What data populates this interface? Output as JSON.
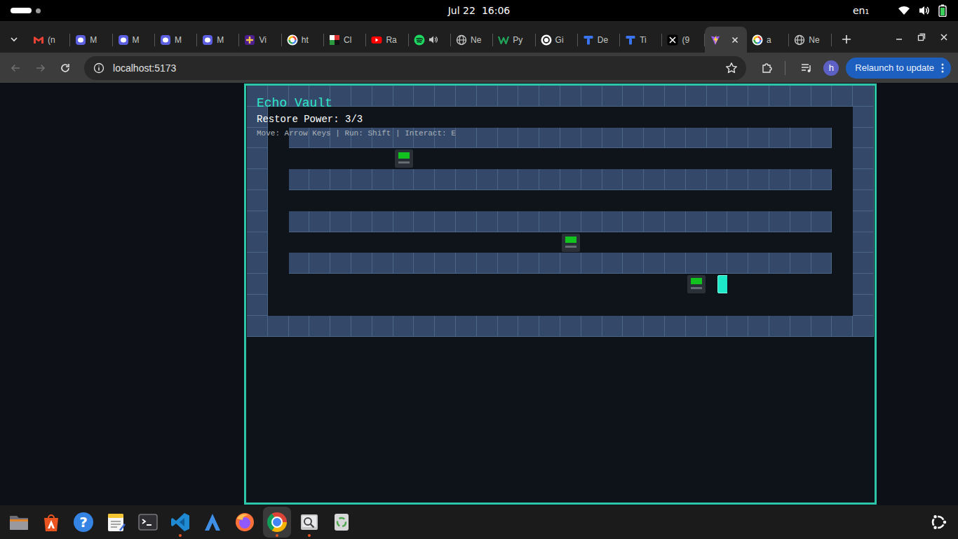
{
  "top_bar": {
    "date": "Jul 22",
    "time": "16:06",
    "keyboard_layout": "en₁"
  },
  "browser": {
    "tabs": [
      {
        "label": "(n",
        "kind": "gmail",
        "selected": false,
        "audio": false
      },
      {
        "label": "M",
        "kind": "mastodon",
        "selected": false,
        "audio": false
      },
      {
        "label": "M",
        "kind": "mastodon",
        "selected": false,
        "audio": false
      },
      {
        "label": "M",
        "kind": "mastodon",
        "selected": false,
        "audio": false
      },
      {
        "label": "M",
        "kind": "mastodon",
        "selected": false,
        "audio": false
      },
      {
        "label": "Vi",
        "kind": "spark",
        "selected": false,
        "audio": false
      },
      {
        "label": "ht",
        "kind": "google",
        "selected": false,
        "audio": false
      },
      {
        "label": "Cl",
        "kind": "chess",
        "selected": false,
        "audio": false
      },
      {
        "label": "Ra",
        "kind": "youtube",
        "selected": false,
        "audio": false
      },
      {
        "label": "",
        "kind": "spotify",
        "selected": false,
        "audio": true
      },
      {
        "label": "Ne",
        "kind": "globe",
        "selected": false,
        "audio": false
      },
      {
        "label": "Py",
        "kind": "w",
        "selected": false,
        "audio": false
      },
      {
        "label": "Gi",
        "kind": "openai",
        "selected": false,
        "audio": false
      },
      {
        "label": "De",
        "kind": "t",
        "selected": false,
        "audio": false
      },
      {
        "label": "Ti",
        "kind": "t",
        "selected": false,
        "audio": false
      },
      {
        "label": "(9",
        "kind": "x",
        "selected": false,
        "audio": false
      },
      {
        "label": "",
        "kind": "vite",
        "selected": true,
        "audio": false
      },
      {
        "label": "a",
        "kind": "google",
        "selected": false,
        "audio": false
      },
      {
        "label": "Ne",
        "kind": "globe",
        "selected": false,
        "audio": false
      }
    ],
    "address": "localhost:5173",
    "relaunch_button": "Relaunch to update",
    "profile_initial": "h"
  },
  "game": {
    "title": "Echo Vault",
    "status": "Restore Power: 3/3",
    "controls": "Move: Arrow Keys | Run: Shift | Interact: E",
    "map": [
      "##############################",
      "#............................#",
      "#.##########################.#",
      "#......T.....................#",
      "#.##########################.#",
      "#............................#",
      "#.##########################.#",
      "#..............T.............#",
      "#.##########################.#",
      "#....................TP......#",
      "#............................#",
      "##############################"
    ],
    "terminals": [
      {
        "powered": true
      },
      {
        "powered": true
      },
      {
        "powered": true
      }
    ]
  },
  "dock": {
    "apps": [
      {
        "kind": "files",
        "running": false,
        "selected": false
      },
      {
        "kind": "app-center",
        "running": false,
        "selected": false
      },
      {
        "kind": "help",
        "glyph": "?",
        "running": false,
        "selected": false
      },
      {
        "kind": "text-editor",
        "running": false,
        "selected": false
      },
      {
        "kind": "terminal",
        "running": false,
        "selected": false
      },
      {
        "kind": "vscode",
        "running": true,
        "selected": false
      },
      {
        "kind": "arrow",
        "running": false,
        "selected": false
      },
      {
        "kind": "firefox",
        "running": false,
        "selected": false
      },
      {
        "kind": "chrome",
        "running": true,
        "selected": true
      },
      {
        "kind": "image-viewer",
        "running": true,
        "selected": false
      },
      {
        "kind": "trash",
        "running": false,
        "selected": false
      }
    ]
  }
}
